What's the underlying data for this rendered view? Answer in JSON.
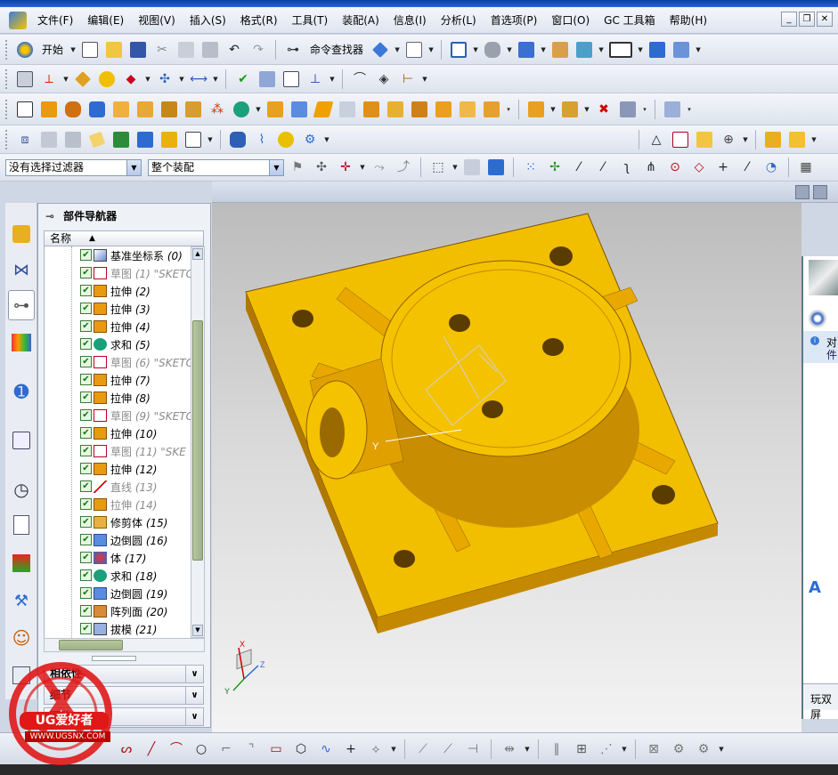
{
  "menu": {
    "items": [
      "文件(F)",
      "编辑(E)",
      "视图(V)",
      "插入(S)",
      "格式(R)",
      "工具(T)",
      "装配(A)",
      "信息(I)",
      "分析(L)",
      "首选项(P)",
      "窗口(O)",
      "GC 工具箱",
      "帮助(H)"
    ]
  },
  "toolbar": {
    "start_label": "开始",
    "command_finder_label": "命令查找器",
    "filter_value": "没有选择过滤器",
    "assembly_scope_value": "整个装配"
  },
  "navigator": {
    "title": "部件导航器",
    "column_name": "名称",
    "rows": [
      {
        "name": "基准坐标系",
        "num": "(0)",
        "icon": "datum-csys",
        "dim": false
      },
      {
        "name": "草图",
        "num": "(1) \"SKETC",
        "icon": "sketch",
        "dim": true
      },
      {
        "name": "拉伸",
        "num": "(2)",
        "icon": "extrude",
        "dim": false
      },
      {
        "name": "拉伸",
        "num": "(3)",
        "icon": "extrude",
        "dim": false
      },
      {
        "name": "拉伸",
        "num": "(4)",
        "icon": "extrude",
        "dim": false
      },
      {
        "name": "求和",
        "num": "(5)",
        "icon": "unite",
        "dim": false
      },
      {
        "name": "草图",
        "num": "(6) \"SKETC",
        "icon": "sketch",
        "dim": true
      },
      {
        "name": "拉伸",
        "num": "(7)",
        "icon": "extrude",
        "dim": false
      },
      {
        "name": "拉伸",
        "num": "(8)",
        "icon": "extrude",
        "dim": false
      },
      {
        "name": "草图",
        "num": "(9) \"SKETC",
        "icon": "sketch",
        "dim": true
      },
      {
        "name": "拉伸",
        "num": "(10)",
        "icon": "extrude",
        "dim": false
      },
      {
        "name": "草图",
        "num": "(11) \"SKE",
        "icon": "sketch",
        "dim": true
      },
      {
        "name": "拉伸",
        "num": "(12)",
        "icon": "extrude",
        "dim": false
      },
      {
        "name": "直线",
        "num": "(13)",
        "icon": "line",
        "dim": true
      },
      {
        "name": "拉伸",
        "num": "(14)",
        "icon": "extrude",
        "dim": true
      },
      {
        "name": "修剪体",
        "num": "(15)",
        "icon": "trim-body",
        "dim": false
      },
      {
        "name": "边倒圆",
        "num": "(16)",
        "icon": "edge-blend",
        "dim": false
      },
      {
        "name": "体",
        "num": "(17)",
        "icon": "body",
        "dim": false
      },
      {
        "name": "求和",
        "num": "(18)",
        "icon": "unite",
        "dim": false
      },
      {
        "name": "边倒圆",
        "num": "(19)",
        "icon": "edge-blend",
        "dim": false
      },
      {
        "name": "阵列面",
        "num": "(20)",
        "icon": "pattern-face",
        "dim": false
      },
      {
        "name": "拔模",
        "num": "(21)",
        "icon": "draft",
        "dim": false
      }
    ],
    "panels": [
      "相依性",
      "细节",
      "预览"
    ]
  },
  "viewport": {
    "axis_y": "Y",
    "triad_x": "X",
    "triad_y": "Y",
    "triad_z": "Z"
  },
  "right_panel": {
    "text1": "对",
    "text2": "件",
    "text3": "玩双屏"
  },
  "watermark": {
    "brand": "UG爱好者",
    "url": "WWW.UGSNX.COM"
  },
  "colors": {
    "part_yellow": "#f5bf00",
    "part_dark": "#b07800",
    "check_green": "#0b7a0b"
  }
}
